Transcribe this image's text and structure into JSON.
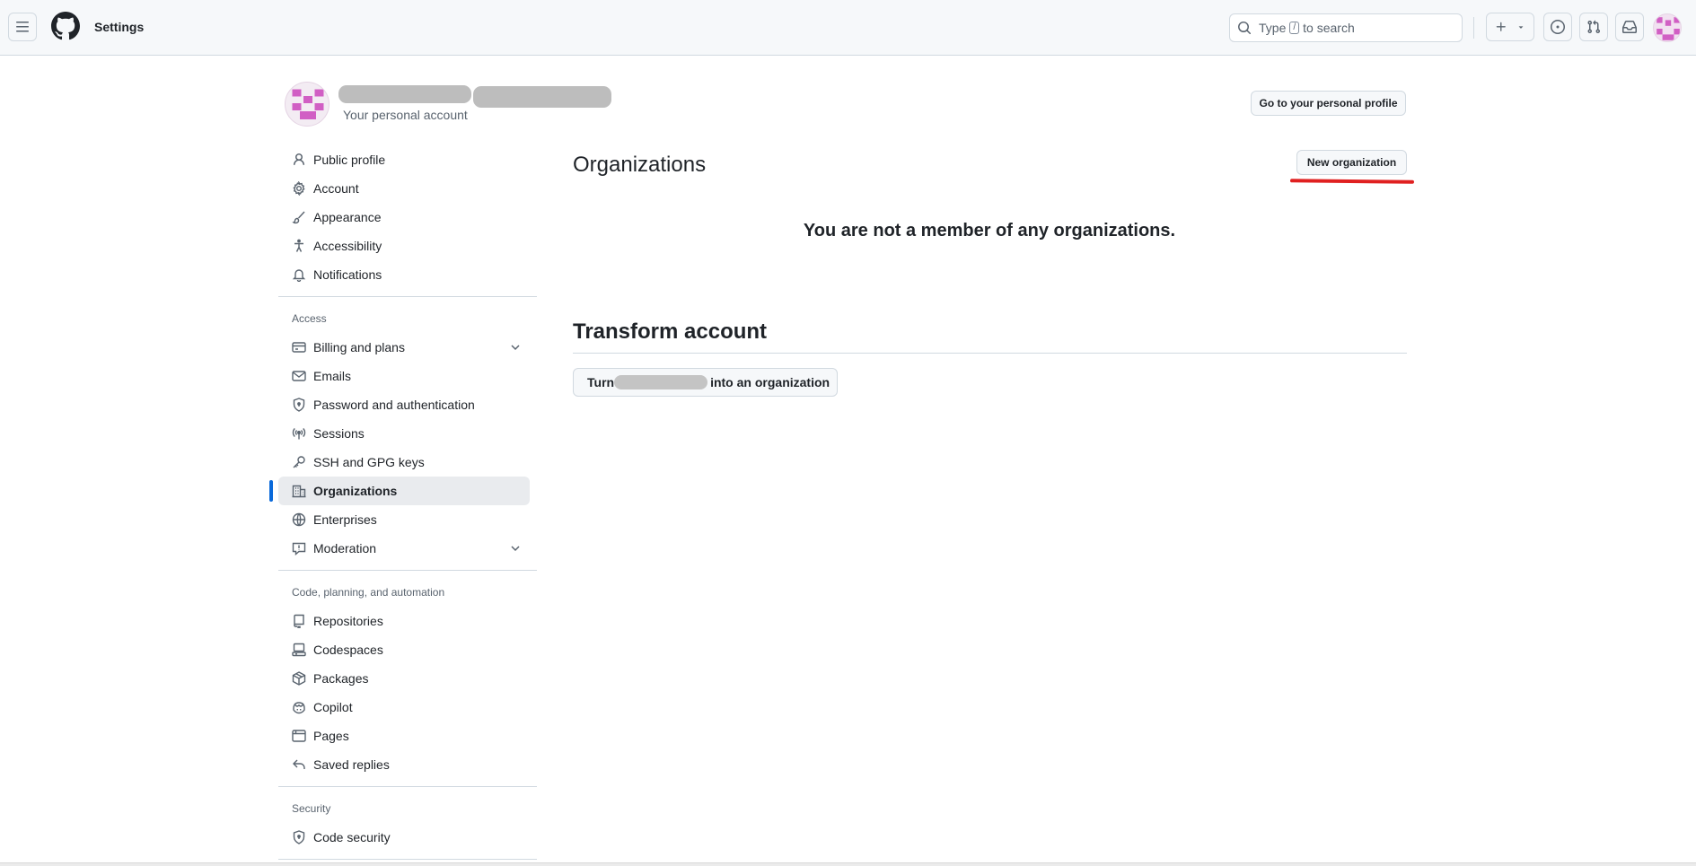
{
  "header": {
    "context_title": "Settings",
    "search": {
      "prefix": "Type",
      "key": "/",
      "suffix": "to search"
    }
  },
  "profile": {
    "subtitle": "Your personal account",
    "goto_profile_label": "Go to your personal profile"
  },
  "sidebar": {
    "group1": [
      {
        "label": "Public profile",
        "icon": "person-icon"
      },
      {
        "label": "Account",
        "icon": "gear-icon"
      },
      {
        "label": "Appearance",
        "icon": "paintbrush-icon"
      },
      {
        "label": "Accessibility",
        "icon": "accessibility-icon"
      },
      {
        "label": "Notifications",
        "icon": "bell-icon"
      }
    ],
    "access_heading": "Access",
    "group2": [
      {
        "label": "Billing and plans",
        "icon": "credit-card-icon",
        "expandable": true
      },
      {
        "label": "Emails",
        "icon": "mail-icon"
      },
      {
        "label": "Password and authentication",
        "icon": "shield-lock-icon"
      },
      {
        "label": "Sessions",
        "icon": "broadcast-icon"
      },
      {
        "label": "SSH and GPG keys",
        "icon": "key-icon"
      },
      {
        "label": "Organizations",
        "icon": "organization-icon",
        "active": true
      },
      {
        "label": "Enterprises",
        "icon": "globe-icon"
      },
      {
        "label": "Moderation",
        "icon": "report-icon",
        "expandable": true
      }
    ],
    "code_heading": "Code, planning, and automation",
    "group3": [
      {
        "label": "Repositories",
        "icon": "repo-icon"
      },
      {
        "label": "Codespaces",
        "icon": "codespaces-icon"
      },
      {
        "label": "Packages",
        "icon": "package-icon"
      },
      {
        "label": "Copilot",
        "icon": "copilot-icon"
      },
      {
        "label": "Pages",
        "icon": "browser-icon"
      },
      {
        "label": "Saved replies",
        "icon": "reply-icon"
      }
    ],
    "security_heading": "Security",
    "group4": [
      {
        "label": "Code security",
        "icon": "shield-check-icon"
      }
    ]
  },
  "main": {
    "organizations_title": "Organizations",
    "new_org_label": "New organization",
    "empty_message": "You are not a member of any organizations.",
    "transform_title": "Transform account",
    "turn_prefix": "Turn",
    "turn_suffix": "into an organization"
  },
  "colors": {
    "accent": "#0969da",
    "annotation_red": "#e02020",
    "avatar_pink": "#d15fc4"
  }
}
